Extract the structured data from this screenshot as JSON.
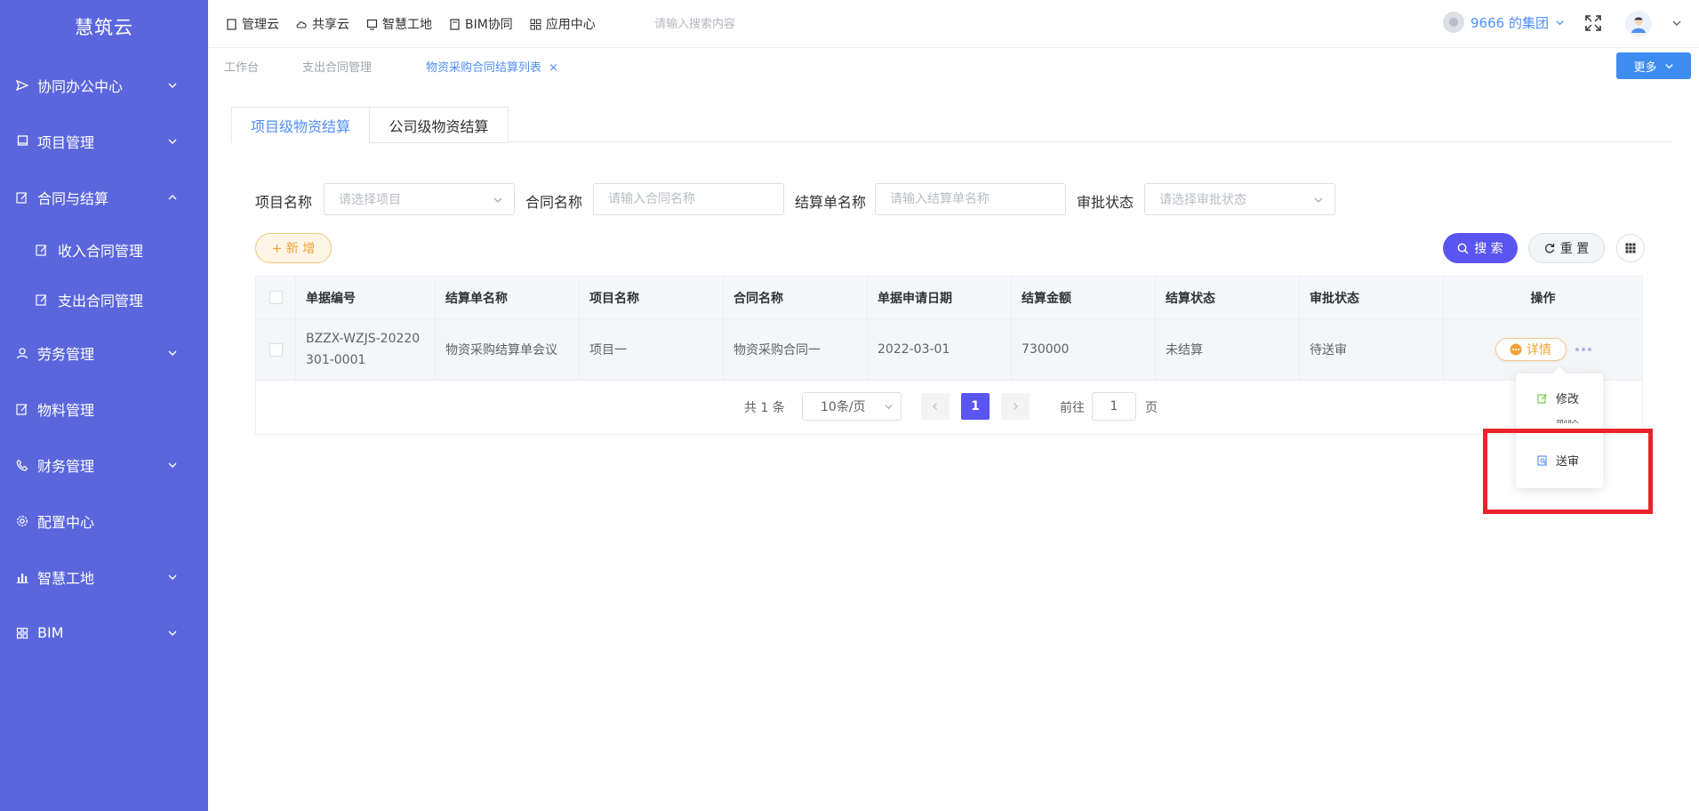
{
  "app": {
    "title": "慧筑云",
    "accent": "#5b66dd",
    "primary": "#5a55f0"
  },
  "sidebar": {
    "items": [
      {
        "label": "协同办公中心",
        "icon": "send-icon",
        "expanded": false
      },
      {
        "label": "项目管理",
        "icon": "book-icon",
        "expanded": false
      },
      {
        "label": "合同与结算",
        "icon": "edit-icon",
        "expanded": true
      },
      {
        "label": "劳务管理",
        "icon": "user-group-icon",
        "expanded": false
      },
      {
        "label": "物料管理",
        "icon": "edit-icon",
        "expanded": false
      },
      {
        "label": "财务管理",
        "icon": "phone-icon",
        "expanded": false
      },
      {
        "label": "配置中心",
        "icon": "gear-icon",
        "expanded": false
      },
      {
        "label": "智慧工地",
        "icon": "bar-chart-icon",
        "expanded": false
      },
      {
        "label": "BIM",
        "icon": "grid-icon",
        "expanded": false
      }
    ],
    "sub_items": [
      {
        "label": "收入合同管理"
      },
      {
        "label": "支出合同管理"
      }
    ]
  },
  "topbar": {
    "nav": [
      {
        "label": "管理云"
      },
      {
        "label": "共享云"
      },
      {
        "label": "智慧工地"
      },
      {
        "label": "BIM协同"
      },
      {
        "label": "应用中心"
      }
    ],
    "search_placeholder": "请输入搜索内容",
    "org_name": "9666 的集团"
  },
  "page_tabs": [
    {
      "label": "工作台",
      "active": false
    },
    {
      "label": "支出合同管理",
      "active": false
    },
    {
      "label": "物资采购合同结算列表",
      "active": true,
      "close": "×"
    }
  ],
  "more_button": "更多",
  "section_tabs": [
    {
      "label": "项目级物资结算",
      "active": true
    },
    {
      "label": "公司级物资结算",
      "active": false
    }
  ],
  "filters": {
    "project": {
      "label": "项目名称",
      "placeholder": "请选择项目"
    },
    "contract": {
      "label": "合同名称",
      "placeholder": "请输入合同名称"
    },
    "settlement": {
      "label": "结算单名称",
      "placeholder": "请输入结算单名称"
    },
    "approval": {
      "label": "审批状态",
      "placeholder": "请选择审批状态"
    }
  },
  "buttons": {
    "add": "新 增",
    "search": "搜 索",
    "reset": "重 置"
  },
  "table": {
    "headers": [
      "单据编号",
      "结算单名称",
      "项目名称",
      "合同名称",
      "单据申请日期",
      "结算金额",
      "结算状态",
      "审批状态",
      "操作"
    ],
    "rows": [
      {
        "code": "BZZX-WZJS-20220301-0001",
        "name": "物资采购结算单会议",
        "project": "项目一",
        "contract": "物资采购合同一",
        "date": "2022-03-01",
        "amount": "730000",
        "settle_status": "未结算",
        "approval_status": "待送审",
        "action": "详情"
      }
    ]
  },
  "pagination": {
    "total_text": "共 1 条",
    "page_size": "10条/页",
    "current_page": "1",
    "goto_label": "前往",
    "goto_value": "1",
    "page_suffix": "页"
  },
  "dropdown_menu": {
    "items": [
      {
        "label": "修改",
        "icon": "edit-icon",
        "color": "#67c23a"
      },
      {
        "label": "删除",
        "icon": "delete-icon",
        "color": "#f56c6c"
      },
      {
        "label": "送审",
        "icon": "submit-icon",
        "color": "#4f8ff7"
      }
    ]
  },
  "annotation": {
    "highlight_color": "#e9242c"
  }
}
